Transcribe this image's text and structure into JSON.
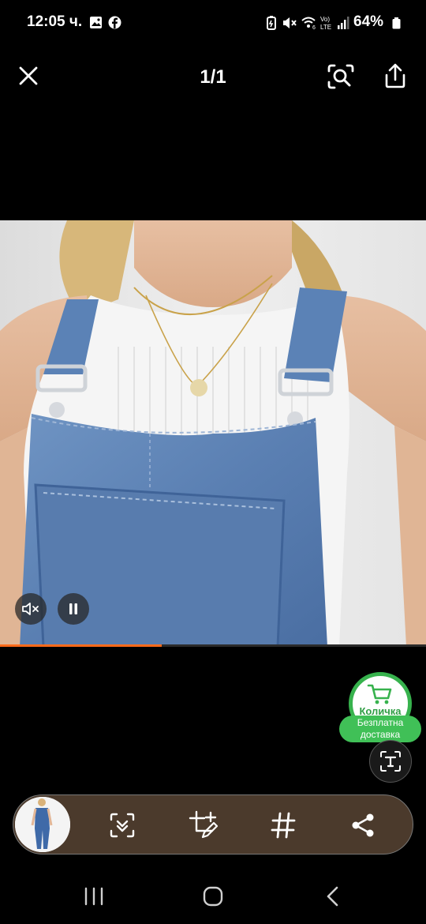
{
  "status_bar": {
    "time": "12:05 ч.",
    "battery": "64%"
  },
  "viewer": {
    "title": "1/1",
    "progress_fraction": 0.38
  },
  "shop": {
    "cart_label": "Количка",
    "shipping_line1": "Безплатна",
    "shipping_line2": "доставка"
  },
  "icons": [
    "close-icon",
    "lens-search-icon",
    "share-icon",
    "mute-icon",
    "pause-icon",
    "cart-icon",
    "text-recognition-icon",
    "scan-icon",
    "edit-crop-icon",
    "hashtag-icon",
    "share-nodes-icon",
    "recents-icon",
    "home-icon",
    "back-icon"
  ],
  "colors": {
    "accent_orange": "#ff6a1a",
    "cart_green": "#40c057",
    "tray_brown": "#4b3a2c"
  }
}
